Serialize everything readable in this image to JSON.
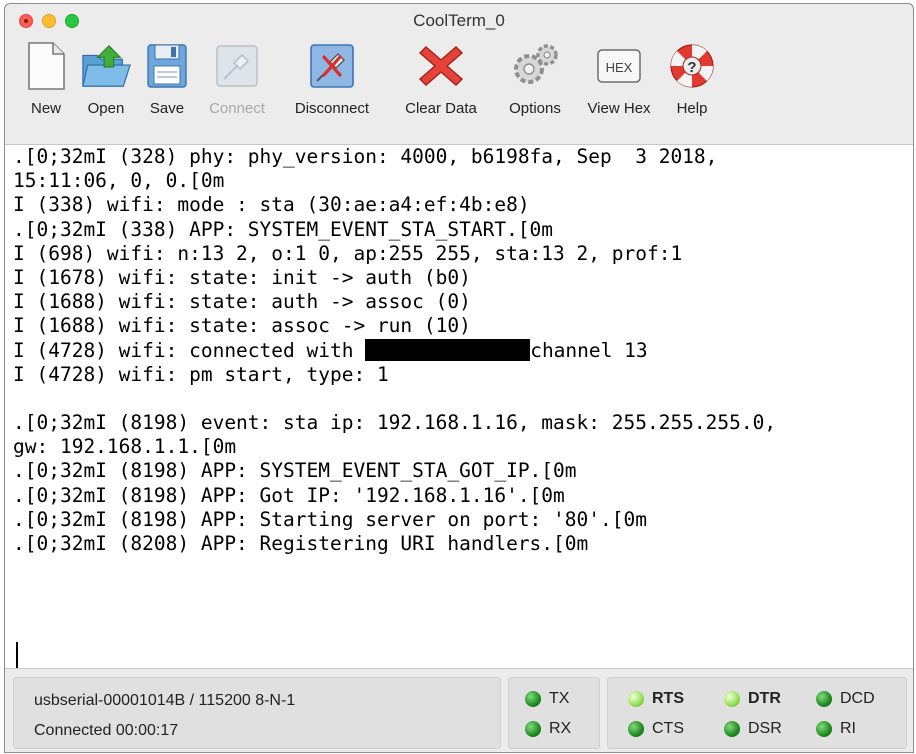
{
  "window": {
    "title": "CoolTerm_0"
  },
  "toolbar": {
    "items": [
      {
        "label": "New",
        "icon": "new-document-icon"
      },
      {
        "label": "Open",
        "icon": "open-folder-icon"
      },
      {
        "label": "Save",
        "icon": "save-disk-icon"
      },
      {
        "label": "Connect",
        "icon": "connect-plug-icon",
        "disabled": true
      },
      {
        "label": "Disconnect",
        "icon": "disconnect-plug-icon"
      },
      {
        "label": "Clear Data",
        "icon": "clear-x-icon"
      },
      {
        "label": "Options",
        "icon": "gears-icon"
      },
      {
        "label": "View Hex",
        "icon": "hex-icon",
        "badge": "HEX"
      },
      {
        "label": "Help",
        "icon": "lifebuoy-icon"
      }
    ]
  },
  "terminal": {
    "lines": [
      ".[0;32mI (328) phy: phy_version: 4000, b6198fa, Sep  3 2018,",
      "15:11:06, 0, 0.[0m",
      "I (338) wifi: mode : sta (30:ae:a4:ef:4b:e8)",
      ".[0;32mI (338) APP: SYSTEM_EVENT_STA_START.[0m",
      "I (698) wifi: n:13 2, o:1 0, ap:255 255, sta:13 2, prof:1",
      "I (1678) wifi: state: init -> auth (b0)",
      "I (1688) wifi: state: auth -> assoc (0)",
      "I (1688) wifi: state: assoc -> run (10)",
      "I (4728) wifi: connected with ",
      "I (4728) wifi: pm start, type: 1",
      "",
      ".[0;32mI (8198) event: sta ip: 192.168.1.16, mask: 255.255.255.0,",
      "gw: 192.168.1.1.[0m",
      ".[0;32mI (8198) APP: SYSTEM_EVENT_STA_GOT_IP.[0m",
      ".[0;32mI (8198) APP: Got IP: '192.168.1.16'.[0m",
      ".[0;32mI (8198) APP: Starting server on port: '80'.[0m",
      ".[0;32mI (8208) APP: Registering URI handlers.[0m"
    ],
    "line9_suffix": "channel 13"
  },
  "status": {
    "port": "usbserial-00001014B / 115200 8-N-1",
    "connection": "Connected 00:00:17",
    "leds": {
      "tx": "TX",
      "rx": "RX",
      "rts": "RTS",
      "cts": "CTS",
      "dtr": "DTR",
      "dsr": "DSR",
      "dcd": "DCD",
      "ri": "RI"
    }
  }
}
